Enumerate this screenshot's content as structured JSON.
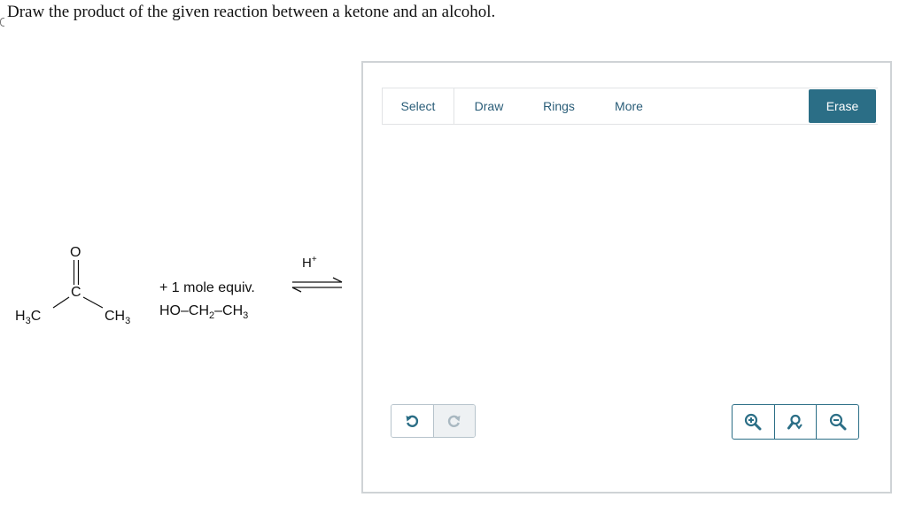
{
  "question": {
    "text": "Draw the product of the given reaction between a ketone and an alcohol."
  },
  "reaction": {
    "ketone": {
      "oxygen": "O",
      "carbon": "C",
      "left_group": "H",
      "left_sub": "3",
      "left_c": "C",
      "right_c": "CH",
      "right_sub": "3"
    },
    "reagent_line1": "+ 1 mole equiv.",
    "reagent_line2": {
      "p1": "HO–CH",
      "s1": "2",
      "p2": "–CH",
      "s2": "3"
    },
    "catalyst": {
      "base": "H",
      "sup": "+"
    }
  },
  "editor": {
    "tabs": {
      "select": "Select",
      "draw": "Draw",
      "rings": "Rings",
      "more": "More"
    },
    "erase": "Erase",
    "colors": {
      "accent": "#2b6e86",
      "tab_text": "#2a5d78",
      "border": "#cfd3d6"
    },
    "icons": {
      "undo": "undo-icon",
      "redo": "redo-icon",
      "zoom_in": "zoom-in-icon",
      "reset": "reset-zoom-icon",
      "zoom_out": "zoom-out-icon"
    }
  }
}
